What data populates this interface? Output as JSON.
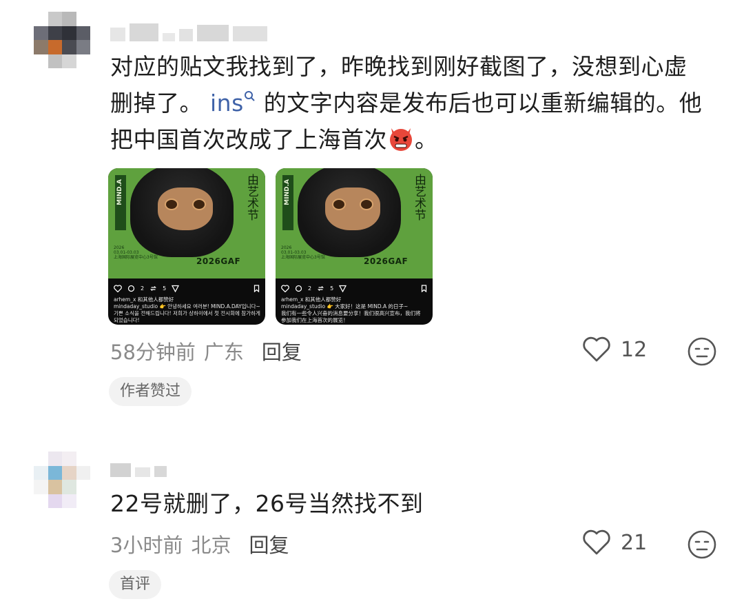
{
  "comments": [
    {
      "text_line1": "对应的贴文我找到了，昨晚找到刚好截图了，没想到心虚",
      "text_line2_a": "删掉了。",
      "text_link": "ins",
      "text_line2_b": "的文字内容是发布后也可以重新编辑的。他",
      "text_line3": "把中国首次改成了上海首次",
      "text_line3_end": "。",
      "emoji": "angry-devil-face",
      "time": "58分钟前",
      "location": "广东",
      "reply_label": "回复",
      "likes": "12",
      "tag": "作者赞过",
      "screenshots": [
        {
          "poster_side": "MIND.A",
          "poster_title": "由艺术节",
          "poster_year": "2026",
          "poster_dates": "03.01-03.03",
          "poster_venue": "上海国际展览中心3号馆",
          "poster_gaf": "2026GAF",
          "likes_count": "2",
          "reposts_count": "5",
          "line1": "arhem_x 和其他人都赞好",
          "line2": "mindaday_studio 👉 안녕하세요 여러분! MIND.A.DAY입니다~",
          "line3": "기쁜 소식을 전해드립니다! 저희가 상하이에서 첫 전시회에 참가하게",
          "line4": "되었습니다!"
        },
        {
          "poster_side": "MIND.A",
          "poster_title": "由艺术节",
          "poster_year": "2026",
          "poster_dates": "03.01-03.03",
          "poster_venue": "上海国际展览中心3号馆",
          "poster_gaf": "2026GAF",
          "likes_count": "2",
          "reposts_count": "5",
          "line1": "arhem_x 和其他人都赞好",
          "line2": "mindaday_studio 👉 大家好！这是 MIND.A 的日子~",
          "line3": "我们有一些令人兴奋的消息要分享！我们很高兴宣布，我们将",
          "line4": "参加我们在上海首次的展览！"
        }
      ]
    },
    {
      "text": "22号就删了，26号当然找不到",
      "time": "3小时前",
      "location": "北京",
      "reply_label": "回复",
      "likes": "21",
      "tag": "首评"
    }
  ],
  "colors": {
    "link": "#3f62a8",
    "poster_green": "#5fa13e",
    "tag_bg": "#f2f2f2",
    "meta_gray": "#8a8a8a"
  },
  "icons": [
    "heart-outline-icon",
    "neutral-face-icon",
    "search-superscript-icon",
    "angry-devil-emoji"
  ]
}
